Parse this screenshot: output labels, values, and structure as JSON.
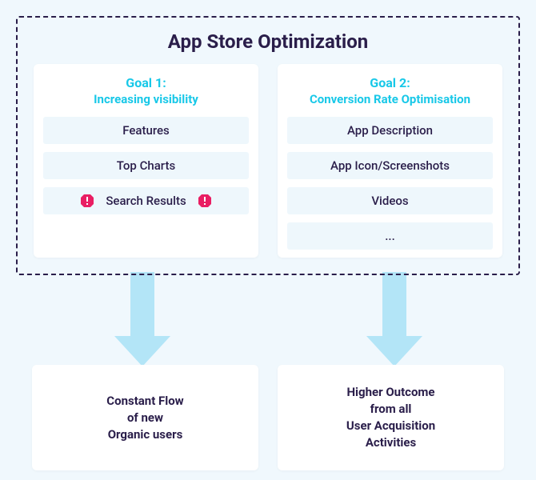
{
  "title": "App Store Optimization",
  "goal1": {
    "label": "Goal 1:",
    "sub": "Increasing visibility",
    "items": [
      "Features",
      "Top Charts",
      "Search Results"
    ]
  },
  "goal2": {
    "label": "Goal 2:",
    "sub": "Conversion Rate Optimisation",
    "items": [
      "App Description",
      "App Icon/Screenshots",
      "Videos",
      "..."
    ]
  },
  "outcome1": "Constant Flow\nof new\nOrganic users",
  "outcome2": "Higher Outcome\nfrom all\nUser Acquisition\nActivities"
}
